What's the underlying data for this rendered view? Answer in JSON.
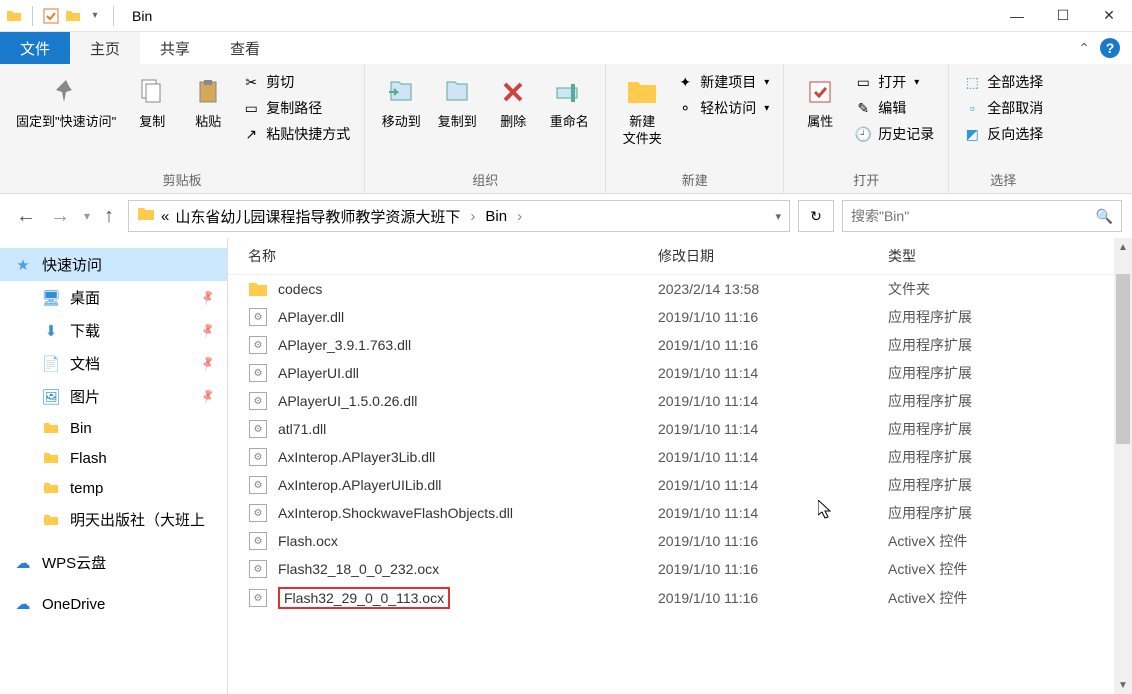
{
  "window": {
    "title": "Bin",
    "min": "—",
    "max": "☐",
    "close": "✕"
  },
  "tabs": {
    "file": "文件",
    "home": "主页",
    "share": "共享",
    "view": "查看"
  },
  "ribbon": {
    "clipboard": {
      "pin": "固定到\"快速访问\"",
      "copy": "复制",
      "paste": "粘贴",
      "cut": "剪切",
      "copypath": "复制路径",
      "pasteshort": "粘贴快捷方式",
      "label": "剪贴板"
    },
    "organize": {
      "moveto": "移动到",
      "copyto": "复制到",
      "delete": "删除",
      "rename": "重命名",
      "label": "组织"
    },
    "new": {
      "newfolder": "新建\n文件夹",
      "newitem": "新建项目",
      "easyaccess": "轻松访问",
      "label": "新建"
    },
    "open": {
      "properties": "属性",
      "open": "打开",
      "edit": "编辑",
      "history": "历史记录",
      "label": "打开"
    },
    "select": {
      "selectall": "全部选择",
      "selectnone": "全部取消",
      "invert": "反向选择",
      "label": "选择"
    }
  },
  "address": {
    "ellipsis": "«",
    "parent": "山东省幼儿园课程指导教师教学资源大班下",
    "current": "Bin",
    "search_placeholder": "搜索\"Bin\""
  },
  "sidebar": {
    "quick": "快速访问",
    "desktop": "桌面",
    "downloads": "下载",
    "documents": "文档",
    "pictures": "图片",
    "bin": "Bin",
    "flash": "Flash",
    "temp": "temp",
    "publisher": "明天出版社（大班上",
    "wps": "WPS云盘",
    "onedrive": "OneDrive"
  },
  "columns": {
    "name": "名称",
    "date": "修改日期",
    "type": "类型"
  },
  "files": [
    {
      "icon": "folder",
      "name": "codecs",
      "date": "2023/2/14 13:58",
      "type": "文件夹"
    },
    {
      "icon": "dll",
      "name": "APlayer.dll",
      "date": "2019/1/10 11:16",
      "type": "应用程序扩展"
    },
    {
      "icon": "dll",
      "name": "APlayer_3.9.1.763.dll",
      "date": "2019/1/10 11:16",
      "type": "应用程序扩展"
    },
    {
      "icon": "dll",
      "name": "APlayerUI.dll",
      "date": "2019/1/10 11:14",
      "type": "应用程序扩展"
    },
    {
      "icon": "dll",
      "name": "APlayerUI_1.5.0.26.dll",
      "date": "2019/1/10 11:14",
      "type": "应用程序扩展"
    },
    {
      "icon": "dll",
      "name": "atl71.dll",
      "date": "2019/1/10 11:14",
      "type": "应用程序扩展"
    },
    {
      "icon": "dll",
      "name": "AxInterop.APlayer3Lib.dll",
      "date": "2019/1/10 11:14",
      "type": "应用程序扩展"
    },
    {
      "icon": "dll",
      "name": "AxInterop.APlayerUILib.dll",
      "date": "2019/1/10 11:14",
      "type": "应用程序扩展"
    },
    {
      "icon": "dll",
      "name": "AxInterop.ShockwaveFlashObjects.dll",
      "date": "2019/1/10 11:14",
      "type": "应用程序扩展"
    },
    {
      "icon": "dll",
      "name": "Flash.ocx",
      "date": "2019/1/10 11:16",
      "type": "ActiveX 控件"
    },
    {
      "icon": "dll",
      "name": "Flash32_18_0_0_232.ocx",
      "date": "2019/1/10 11:16",
      "type": "ActiveX 控件"
    },
    {
      "icon": "dll",
      "name": "Flash32_29_0_0_113.ocx",
      "date": "2019/1/10 11:16",
      "type": "ActiveX 控件",
      "highlighted": true
    }
  ]
}
